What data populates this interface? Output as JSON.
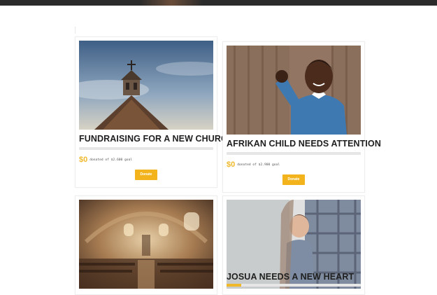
{
  "cards": [
    {
      "title": "FUNDRAISING FOR A NEW CHURCH",
      "amount": "$0",
      "goal_text": "donated of $2.600 goal",
      "donate_label": "Donate",
      "progress_percent": 0
    },
    {
      "title": "AFRIKAN CHILD NEEDS ATTENTION",
      "amount": "$0",
      "goal_text": "donated of $2.900 goal",
      "donate_label": "Donate",
      "progress_percent": 0
    },
    {
      "title": "",
      "progress_percent": 0
    },
    {
      "title": "JOSUA NEEDS A NEW HEART",
      "progress_percent": 11
    }
  ],
  "colors": {
    "accent": "#f0b92b",
    "button": "#f2b31c"
  }
}
